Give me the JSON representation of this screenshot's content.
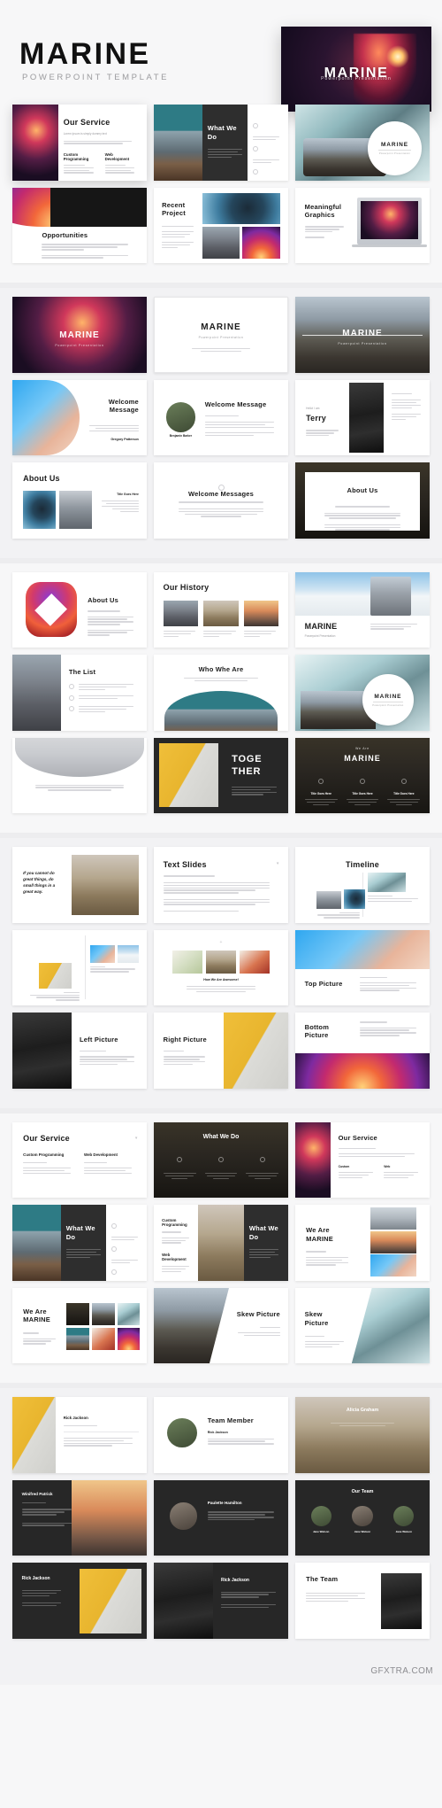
{
  "hero": {
    "title": "MARINE",
    "subtitle": "POWERPOINT TEMPLATE",
    "preview_card": {
      "title": "MARINE",
      "subtitle": "Powerpoint Presentation"
    }
  },
  "footer": {
    "watermark": "GFXTRA.COM"
  },
  "sections": [
    {
      "id": "section-overview",
      "rows": [
        {
          "slides": [
            {
              "name": "our-service",
              "title": "Our Service",
              "sub": "Lorem Ipsum is simply dummy text",
              "cols": [
                {
                  "title": "Custom Programming"
                },
                {
                  "title": "Web Development"
                }
              ]
            },
            {
              "name": "what-we-do",
              "title": "What We Do",
              "sub": "Lorem Ipsum is simply text"
            },
            {
              "name": "marine-circle",
              "badge": {
                "title": "MARINE",
                "sub": "Powerpoint Presentation"
              }
            }
          ]
        },
        {
          "slides": [
            {
              "name": "opportunities",
              "title": "Opportunities"
            },
            {
              "name": "recent-project",
              "title": "Recent Project"
            },
            {
              "name": "meaningful-graphics",
              "title": "Meaningful Graphics"
            }
          ]
        }
      ]
    },
    {
      "id": "section-title-slides",
      "rows": [
        {
          "slides": [
            {
              "name": "title-dark",
              "title": "MARINE",
              "sub": "Powerpoint Presentation"
            },
            {
              "name": "title-light",
              "title": "MARINE",
              "sub": "Powerpoint Presentation"
            },
            {
              "name": "title-photo",
              "title": "MARINE",
              "sub": "Powerpoint Presentation"
            }
          ]
        },
        {
          "slides": [
            {
              "name": "welcome-message-circle",
              "title": "Welcome Message",
              "author": "Gregory Patterson"
            },
            {
              "name": "welcome-message-avatar",
              "title": "Welcome Message",
              "author": "Benjamin Barker"
            },
            {
              "name": "hello-terry",
              "eyebrow": "Hello! I am",
              "title": "Terry"
            }
          ]
        },
        {
          "slides": [
            {
              "name": "about-us-photos",
              "title": "About Us",
              "side_title": "Title Goes Here"
            },
            {
              "name": "welcome-messages",
              "title": "Welcome Messages"
            },
            {
              "name": "about-us-frame",
              "title": "About Us"
            }
          ]
        }
      ]
    },
    {
      "id": "section-about",
      "rows": [
        {
          "slides": [
            {
              "name": "about-us-torus",
              "title": "About Us"
            },
            {
              "name": "our-history",
              "title": "Our History"
            },
            {
              "name": "marine-snow",
              "title": "MARINE",
              "sub": "Powerpoint Presentation"
            }
          ]
        },
        {
          "slides": [
            {
              "name": "the-list",
              "title": "The List"
            },
            {
              "name": "who-whe-are",
              "title": "Who Whe Are"
            },
            {
              "name": "marine-wave-circle",
              "badge": {
                "title": "MARINE",
                "sub": "Powerpoint Presentation"
              }
            }
          ]
        },
        {
          "slides": [
            {
              "name": "quote-architecture"
            },
            {
              "name": "together",
              "title": "TOGE THER"
            },
            {
              "name": "we-are-marine-dark",
              "eyebrow": "We Are",
              "title": "MARINE",
              "items": [
                "Title Goes Here",
                "Title Goes Here",
                "Title Goes Here"
              ]
            }
          ]
        }
      ]
    },
    {
      "id": "section-text",
      "rows": [
        {
          "slides": [
            {
              "name": "quote-slide",
              "quote": "If you cannot do great things, do small things in a great way."
            },
            {
              "name": "text-slides",
              "title": "Text Slides"
            },
            {
              "name": "timeline",
              "title": "Timeline"
            }
          ]
        },
        {
          "slides": [
            {
              "name": "gallery-two-up",
              "label": "2016"
            },
            {
              "name": "how-we-are-awesome",
              "title": "How We Are Awesome!"
            },
            {
              "name": "top-picture",
              "title": "Top Picture"
            }
          ]
        },
        {
          "slides": [
            {
              "name": "left-picture",
              "title": "Left Picture"
            },
            {
              "name": "right-picture",
              "title": "Right Picture"
            },
            {
              "name": "bottom-picture",
              "title": "Bottom Picture"
            }
          ]
        }
      ]
    },
    {
      "id": "section-services",
      "rows": [
        {
          "slides": [
            {
              "name": "our-service-two-col",
              "title": "Our Service",
              "cols": [
                {
                  "title": "Custom Programming"
                },
                {
                  "title": "Web Development"
                }
              ]
            },
            {
              "name": "what-we-do-dark",
              "title": "What We Do"
            },
            {
              "name": "our-service-photo",
              "title": "Our Service",
              "cols": [
                {
                  "title": "Custom"
                },
                {
                  "title": "Web"
                }
              ]
            }
          ]
        },
        {
          "slides": [
            {
              "name": "what-we-do-mountain",
              "title": "What We Do"
            },
            {
              "name": "what-we-do-split",
              "title": "What We Do",
              "cols": [
                {
                  "title": "Custom Programming"
                },
                {
                  "title": "Web Development"
                }
              ]
            },
            {
              "name": "we-are-marine-grid",
              "title": "We Are MARINE"
            }
          ]
        },
        {
          "slides": [
            {
              "name": "we-are-marine-six",
              "title": "We Are MARINE"
            },
            {
              "name": "skew-picture-left",
              "title": "Skew Picture"
            },
            {
              "name": "skew-picture-right",
              "title": "Skew Picture"
            }
          ]
        }
      ]
    },
    {
      "id": "section-team",
      "rows": [
        {
          "slides": [
            {
              "name": "rick-jackson",
              "title": "Rick Jackson"
            },
            {
              "name": "team-member",
              "title": "Team Member",
              "author": "Rick Jackson"
            },
            {
              "name": "alicia-graham",
              "title": "Alicia Graham"
            }
          ]
        },
        {
          "slides": [
            {
              "name": "winifred-patrick",
              "title": "Winifred Patrick"
            },
            {
              "name": "paulette-hamilton",
              "title": "Paulette Hamilton"
            },
            {
              "name": "our-team",
              "title": "Our Team",
              "members": [
                "Jane Watson",
                "Jane Watson",
                "Jane Watson"
              ]
            }
          ]
        },
        {
          "slides": [
            {
              "name": "rick-jackson-dark",
              "title": "Rick Jackson"
            },
            {
              "name": "rick-jackson-photo",
              "title": "Rick Jackson"
            },
            {
              "name": "the-team",
              "title": "The Team"
            }
          ]
        }
      ]
    }
  ]
}
